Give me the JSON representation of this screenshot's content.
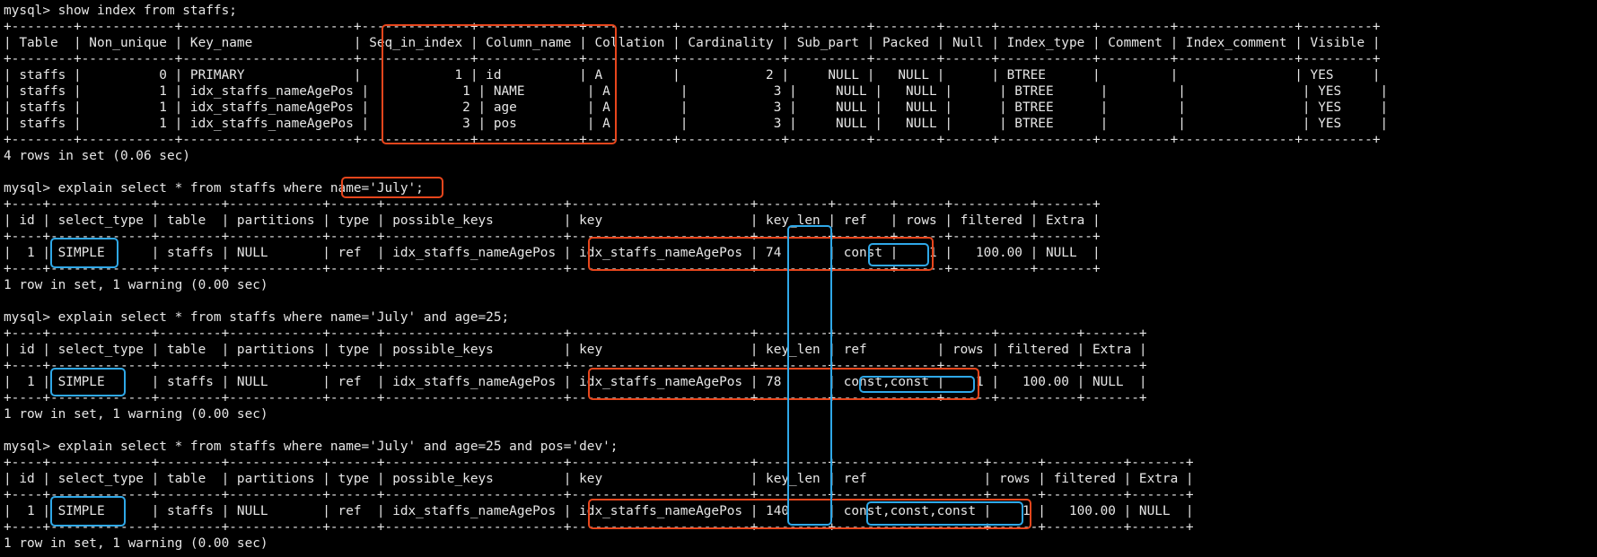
{
  "terminal": {
    "lines": [
      "mysql> show index from staffs;",
      "+--------+------------+----------------------+--------------+-------------+-----------+-------------+----------+--------+------+------------+---------+---------------+---------+",
      "| Table  | Non_unique | Key_name             | Seq_in_index | Column_name | Collation | Cardinality | Sub_part | Packed | Null | Index_type | Comment | Index_comment | Visible |",
      "+--------+------------+----------------------+--------------+-------------+-----------+-------------+----------+--------+------+------------+---------+---------------+---------+",
      "| staffs |          0 | PRIMARY              |            1 | id          | A         |           2 |     NULL |   NULL |      | BTREE      |         |               | YES     |",
      "| staffs |          1 | idx_staffs_nameAgePos |            1 | NAME        | A         |           3 |     NULL |   NULL |      | BTREE      |         |               | YES     |",
      "| staffs |          1 | idx_staffs_nameAgePos |            2 | age         | A         |           3 |     NULL |   NULL |      | BTREE      |         |               | YES     |",
      "| staffs |          1 | idx_staffs_nameAgePos |            3 | pos         | A         |           3 |     NULL |   NULL |      | BTREE      |         |               | YES     |",
      "+--------+------------+----------------------+--------------+-------------+-----------+-------------+----------+--------+------+------------+---------+---------------+---------+",
      "4 rows in set (0.06 sec)",
      "",
      "mysql> explain select * from staffs where name='July';",
      "+----+-------------+--------+------------+------+-----------------------+-----------------------+---------+-------+------+----------+-------+",
      "| id | select_type | table  | partitions | type | possible_keys         | key                   | key_len | ref   | rows | filtered | Extra |",
      "+----+-------------+--------+------------+------+-----------------------+-----------------------+---------+-------+------+----------+-------+",
      "|  1 | SIMPLE      | staffs | NULL       | ref  | idx_staffs_nameAgePos | idx_staffs_nameAgePos | 74      | const |    1 |   100.00 | NULL  |",
      "+----+-------------+--------+------------+------+-----------------------+-----------------------+---------+-------+------+----------+-------+",
      "1 row in set, 1 warning (0.00 sec)",
      "",
      "mysql> explain select * from staffs where name='July' and age=25;",
      "+----+-------------+--------+------------+------+-----------------------+-----------------------+---------+-------------+------+----------+-------+",
      "| id | select_type | table  | partitions | type | possible_keys         | key                   | key_len | ref         | rows | filtered | Extra |",
      "+----+-------------+--------+------------+------+-----------------------+-----------------------+---------+-------------+------+----------+-------+",
      "|  1 | SIMPLE      | staffs | NULL       | ref  | idx_staffs_nameAgePos | idx_staffs_nameAgePos | 78      | const,const |    1 |   100.00 | NULL  |",
      "+----+-------------+--------+------------+------+-----------------------+-----------------------+---------+-------------+------+----------+-------+",
      "1 row in set, 1 warning (0.00 sec)",
      "",
      "mysql> explain select * from staffs where name='July' and age=25 and pos='dev';",
      "+----+-------------+--------+------------+------+-----------------------+-----------------------+---------+-------------------+------+----------+-------+",
      "| id | select_type | table  | partitions | type | possible_keys         | key                   | key_len | ref               | rows | filtered | Extra |",
      "+----+-------------+--------+------------+------+-----------------------+-----------------------+---------+-------------------+------+----------+-------+",
      "|  1 | SIMPLE      | staffs | NULL       | ref  | idx_staffs_nameAgePos | idx_staffs_nameAgePos | 140     | const,const,const |    1 |   100.00 | NULL  |",
      "+----+-------------+--------+------------+------+-----------------------+-----------------------+---------+-------------------+------+----------+-------+",
      "1 row in set, 1 warning (0.00 sec)"
    ]
  },
  "annotation_colors": {
    "red": "#e8461c",
    "blue": "#2fa8e8"
  }
}
